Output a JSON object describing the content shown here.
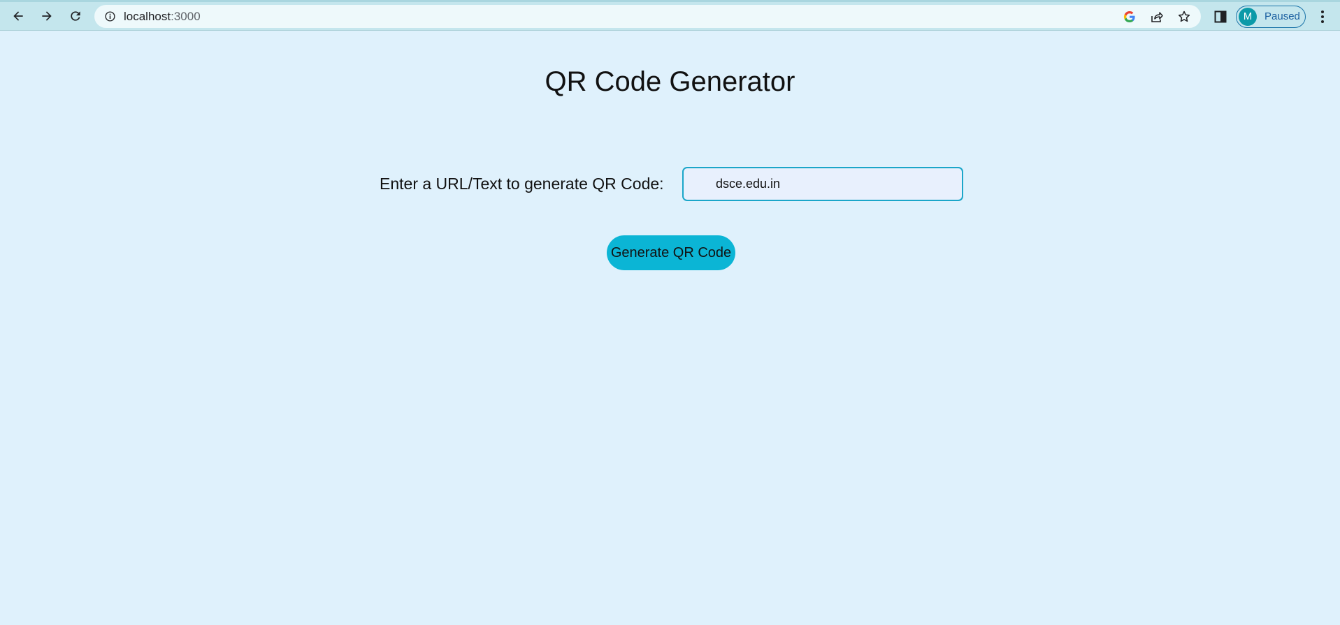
{
  "browser": {
    "url_host": "localhost",
    "url_port": ":3000",
    "profile_initial": "M",
    "profile_status": "Paused",
    "icons": {
      "back": "back-arrow-icon",
      "forward": "forward-arrow-icon",
      "reload": "reload-icon",
      "site_info": "info-icon",
      "google": "google-icon",
      "share": "share-icon",
      "bookmark": "star-icon",
      "side_panel": "side-panel-icon",
      "menu": "kebab-menu-icon"
    }
  },
  "page": {
    "title": "QR Code Generator",
    "input_label": "Enter a URL/Text to generate QR Code:",
    "input_value": "dsce.edu.in",
    "button_label": "Generate QR Code"
  },
  "colors": {
    "page_background": "#dff1fc",
    "toolbar_background": "#c4e6ed",
    "input_border": "#1ba6c9",
    "input_background": "#e8f0fd",
    "button_background": "#0bb5d5",
    "avatar_background": "#0b9aa8"
  }
}
